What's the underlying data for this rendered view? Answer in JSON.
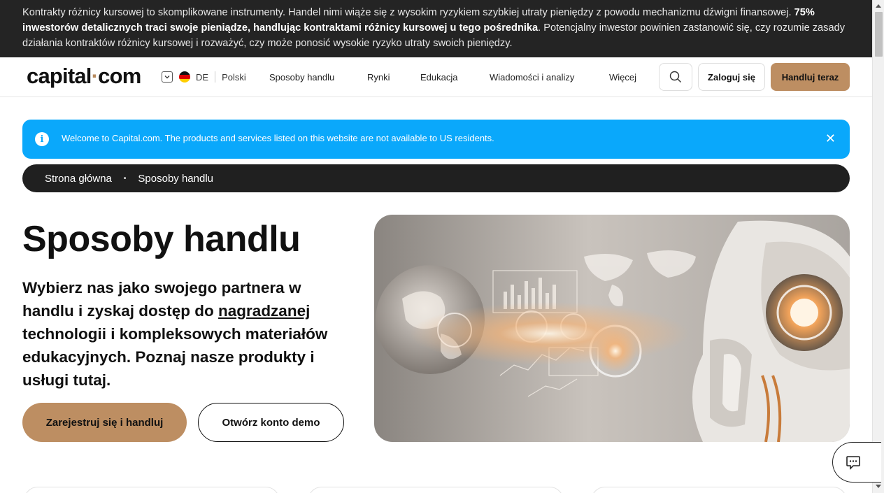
{
  "risk_banner": {
    "text_before": "Kontrakty różnicy kursowej to skomplikowane instrumenty. Handel nimi wiąże się z wysokim ryzykiem szybkiej utraty pieniędzy z powodu mechanizmu dźwigni finansowej. ",
    "text_bold": "75% inwestorów detalicznych traci swoje pieniądze, handlując kontraktami różnicy kursowej u tego pośrednika",
    "text_after": ". Potencjalny inwestor powinien zastanowić się, czy rozumie zasady działania kontraktów różnicy kursowej i rozważyć, czy może ponosić wysokie ryzyko utraty swoich pieniędzy."
  },
  "header": {
    "logo_left": "capital",
    "logo_dot": "·",
    "logo_right": "com",
    "lang_code": "DE",
    "language": "Polski",
    "nav": [
      "Sposoby handlu",
      "Rynki",
      "Edukacja",
      "Wiadomości i analizy",
      "Więcej"
    ],
    "login_label": "Zaloguj się",
    "trade_label": "Handluj teraz"
  },
  "notice": {
    "info_glyph": "i",
    "message": "Welcome to Capital.com. The products and services listed on this website are not available to US residents.",
    "close_glyph": "✕"
  },
  "breadcrumb": {
    "home": "Strona główna",
    "separator": "•",
    "current": "Sposoby handlu"
  },
  "hero": {
    "title": "Sposoby handlu",
    "lead_before": "Wybierz nas jako swojego partnera w handlu i zyskaj dostęp do ",
    "lead_link": "nagradzanej",
    "lead_after": " technologii i kompleksowych materiałów edukacyjnych. Poznaj nasze produkty i usługi tutaj.",
    "register_label": "Zarejestruj się i handluj",
    "demo_label": "Otwórz konto demo"
  },
  "colors": {
    "accent": "#bd8e62",
    "notice": "#0aa8fb",
    "dark": "#202020"
  },
  "icons": {
    "search": "search-icon",
    "chat": "chat-icon",
    "info": "info-icon",
    "close": "close-icon",
    "flag": "german-flag-icon",
    "chevron": "chevron-down-icon"
  }
}
